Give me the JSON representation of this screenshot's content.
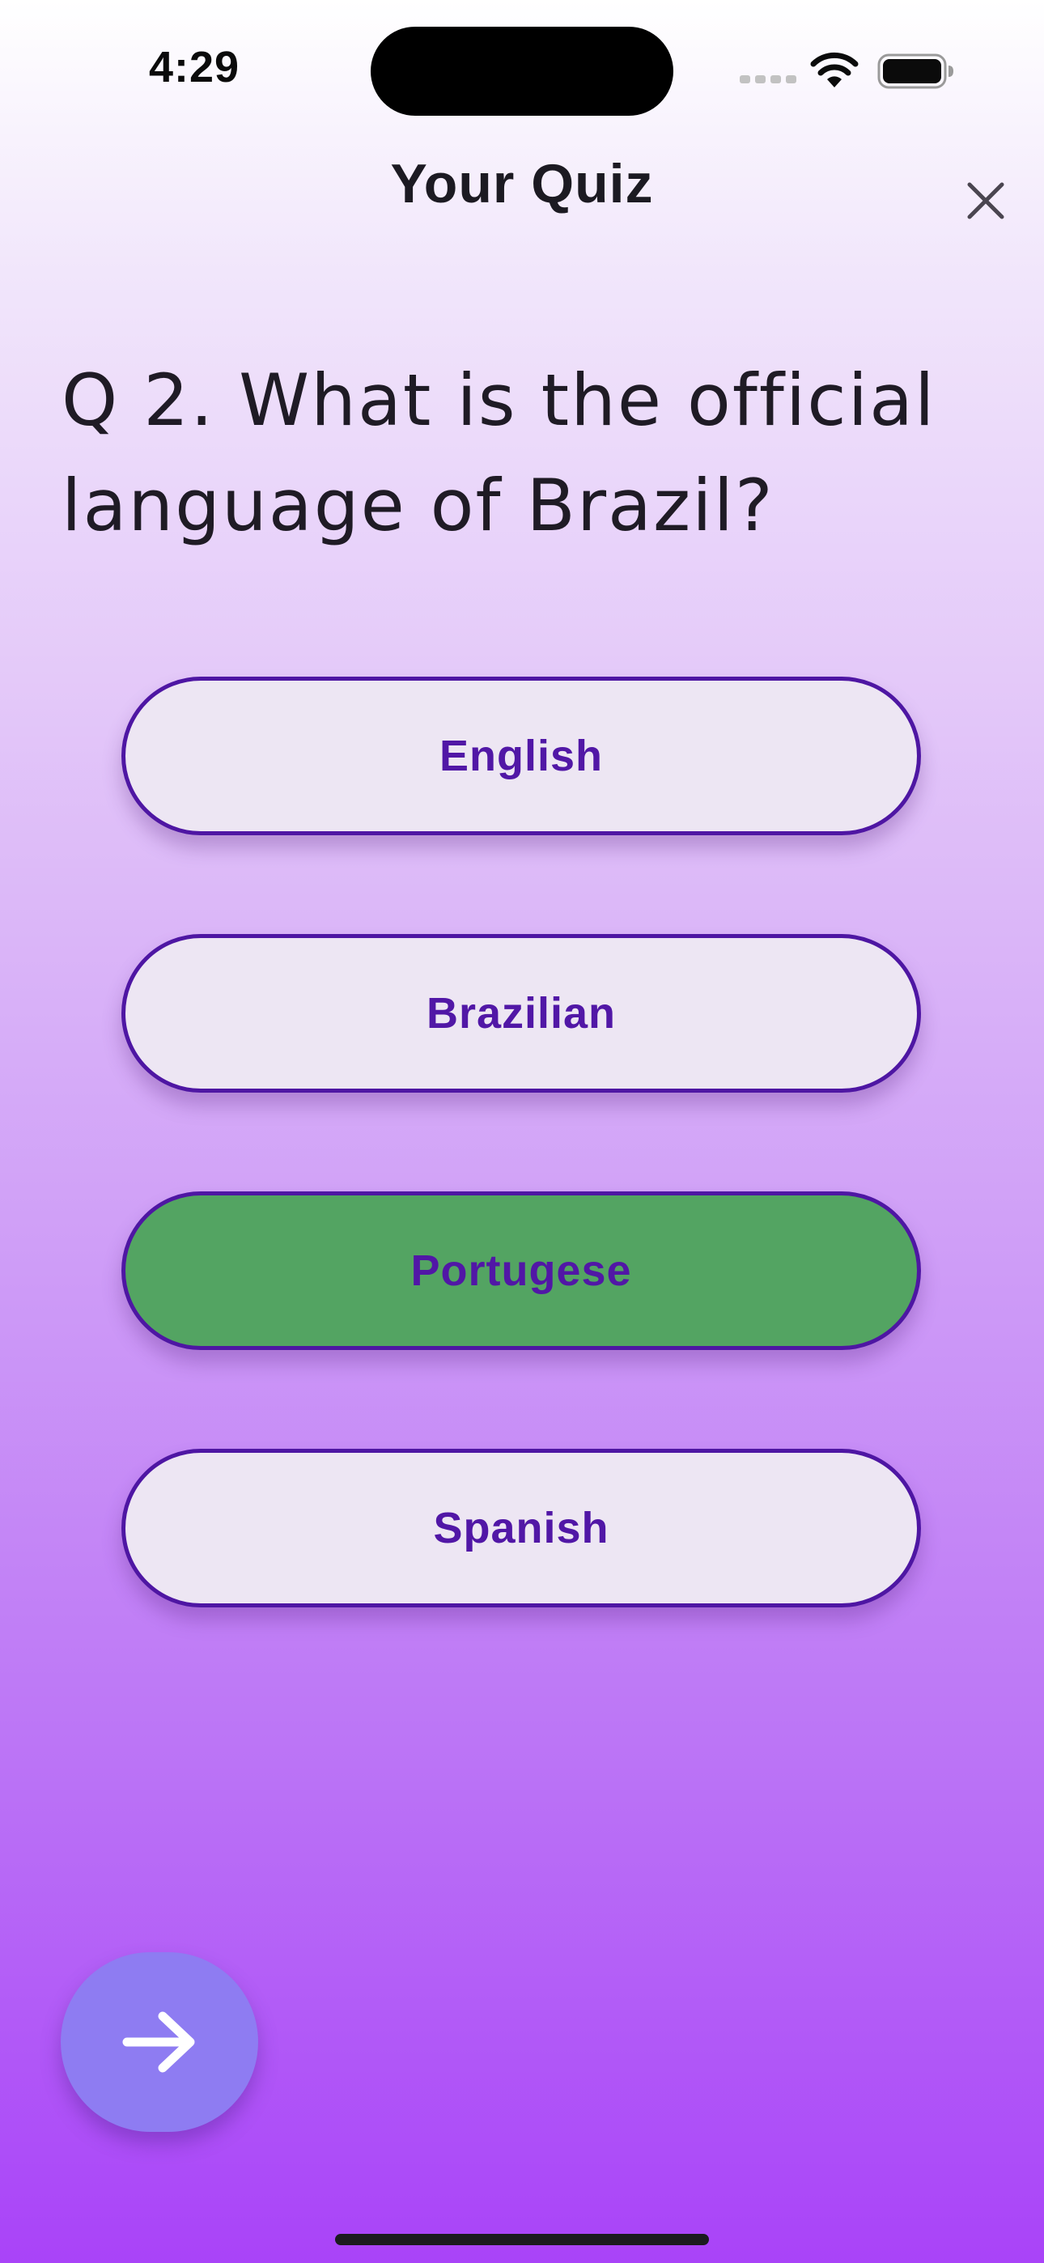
{
  "status_bar": {
    "time": "4:29"
  },
  "header": {
    "title": "Your Quiz",
    "close_icon": "close-icon"
  },
  "question": {
    "text": "Q 2. What is the official language of Brazil?"
  },
  "options": [
    {
      "label": "English",
      "state": "default"
    },
    {
      "label": "Brazilian",
      "state": "default"
    },
    {
      "label": "Portugese",
      "state": "correct"
    },
    {
      "label": "Spanish",
      "state": "default"
    }
  ],
  "next_button": {
    "icon": "arrow-right-icon"
  },
  "colors": {
    "accent": "#5117a6",
    "option_background": "#ede6f3",
    "correct_background": "#53a462",
    "fab_background": "#8e7cf2"
  }
}
